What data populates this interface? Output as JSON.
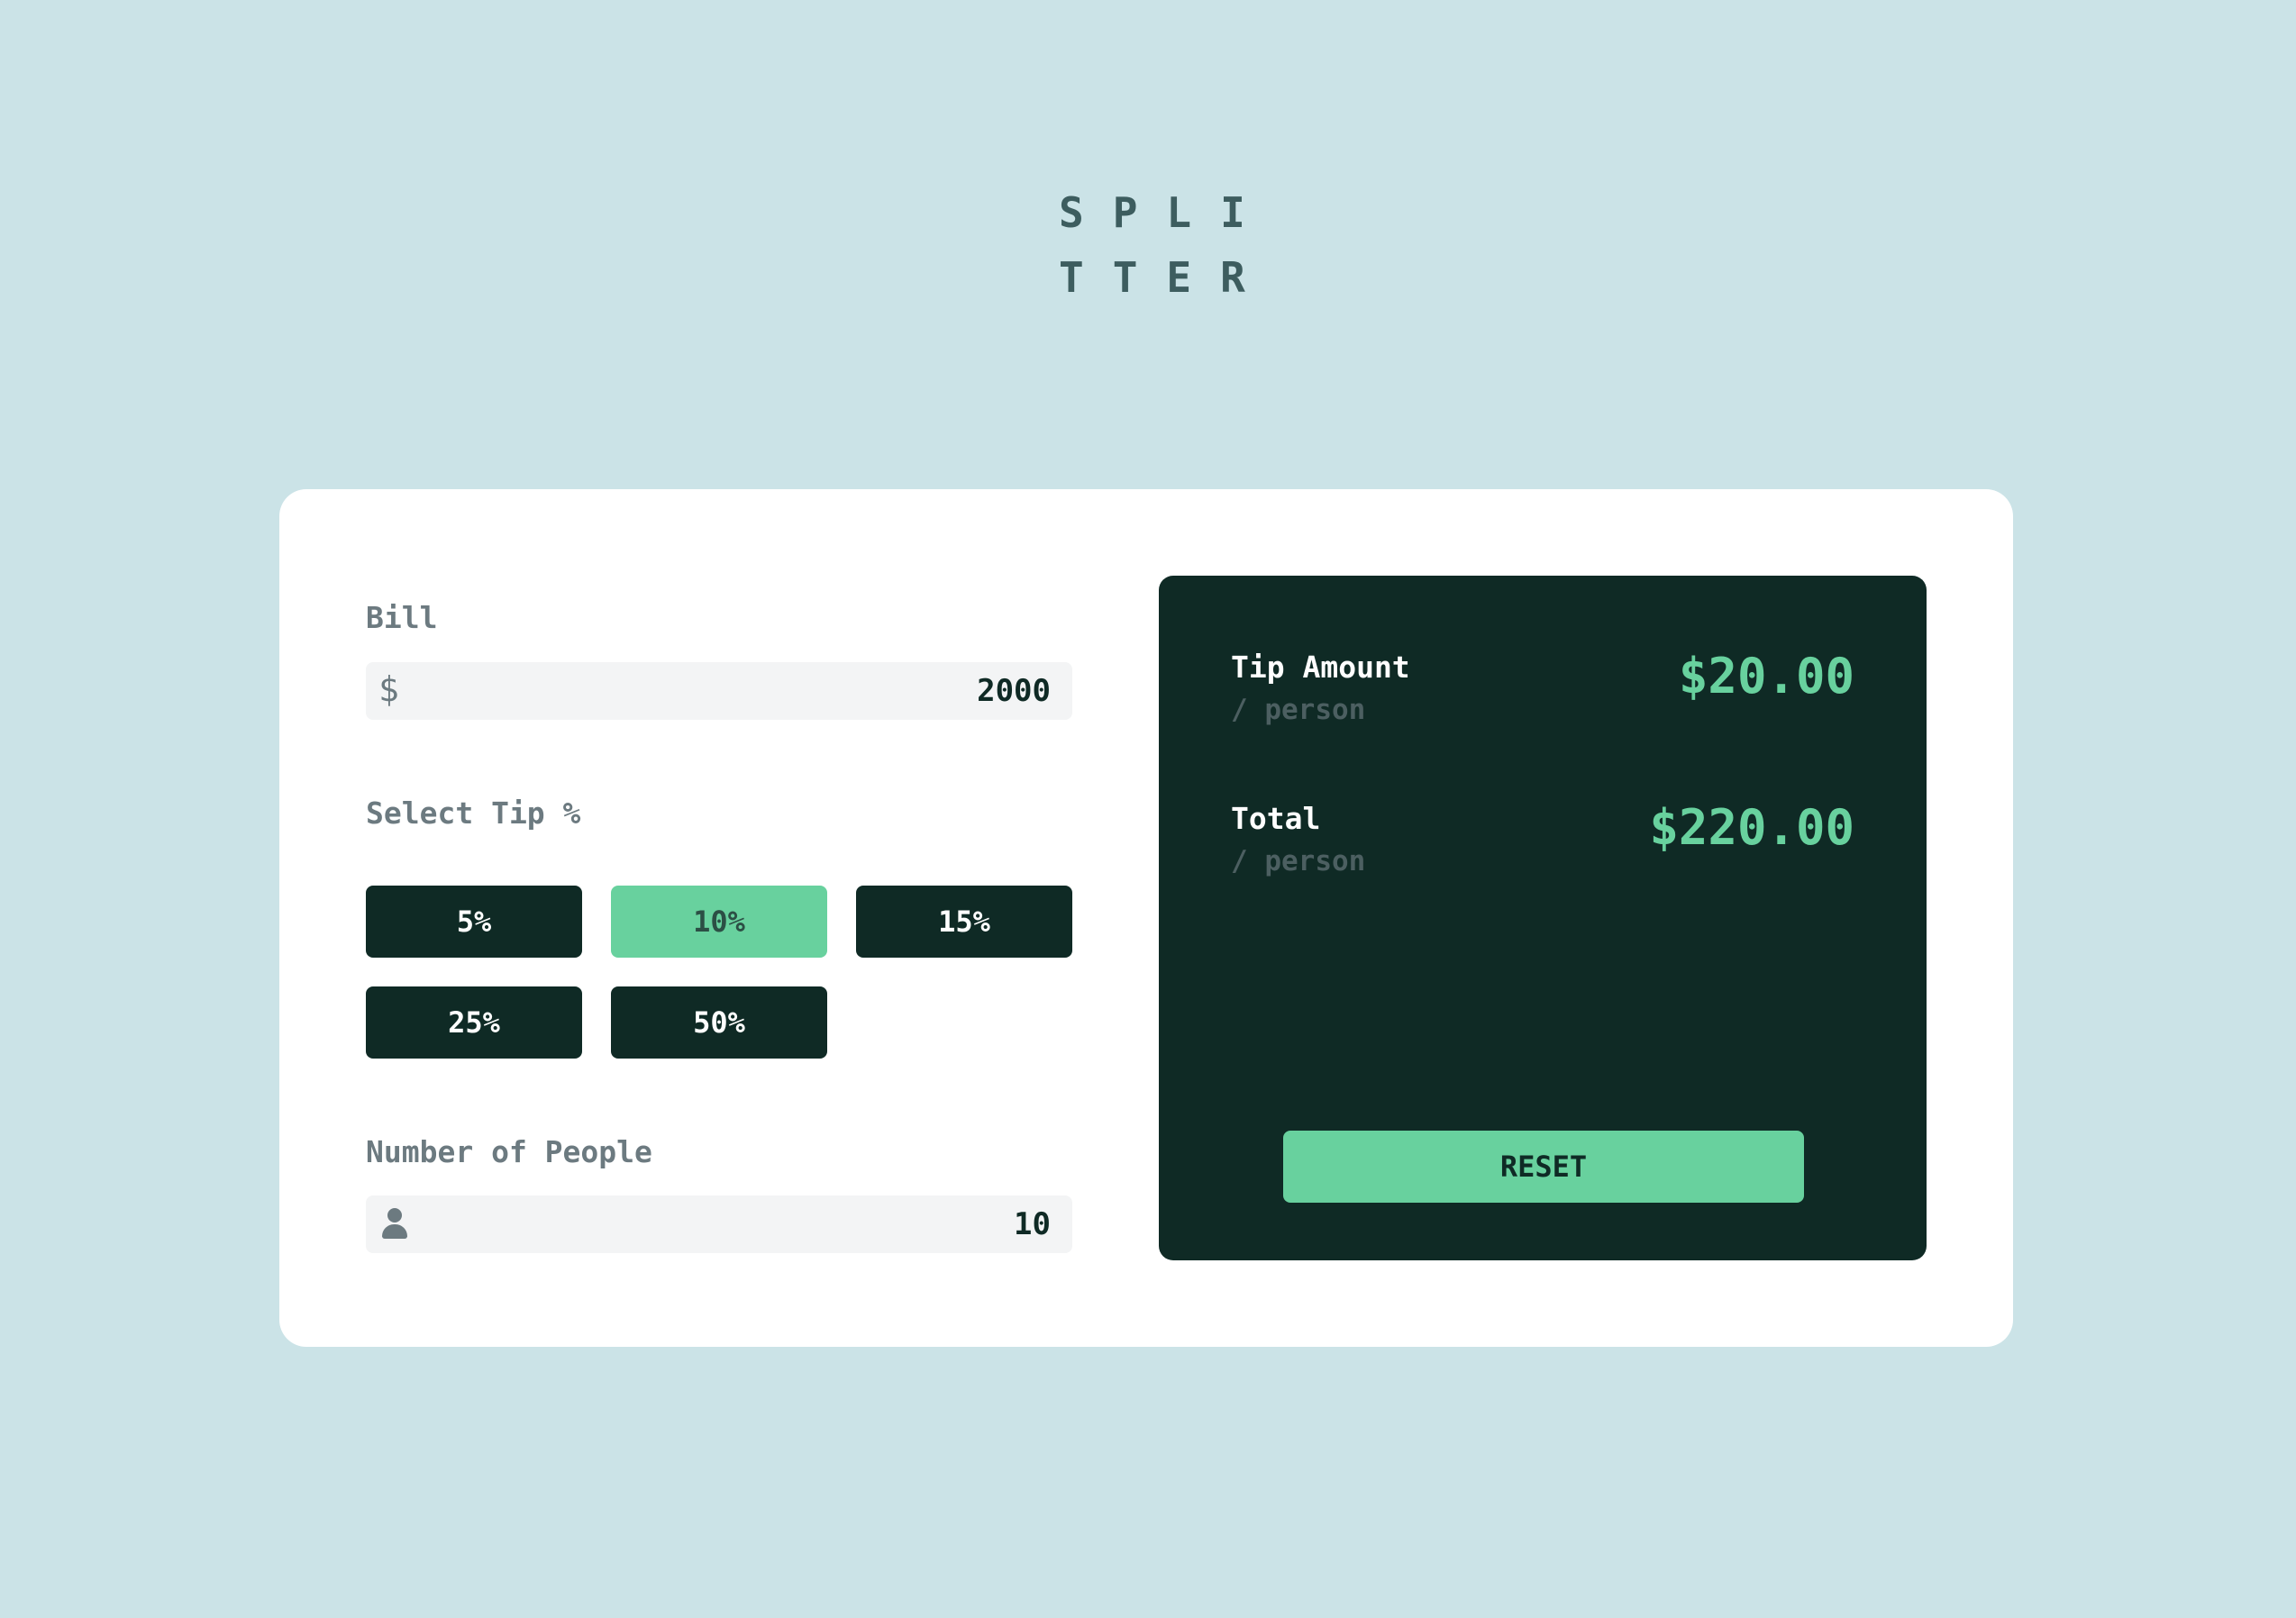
{
  "logo": {
    "line1": "SPLI",
    "line2": "TTER"
  },
  "bill": {
    "label": "Bill",
    "currency_symbol": "$",
    "value": "2000"
  },
  "tip": {
    "label": "Select Tip %",
    "options": [
      "5%",
      "10%",
      "15%",
      "25%",
      "50%"
    ],
    "selected": "10%"
  },
  "people": {
    "label": "Number of People",
    "icon": "person-icon",
    "value": "10"
  },
  "results": {
    "tip_amount": {
      "label": "Tip Amount",
      "sub": "/ person",
      "value": "$20.00"
    },
    "total": {
      "label": "Total",
      "sub": "/ person",
      "value": "$220.00"
    },
    "reset_label": "RESET"
  },
  "colors": {
    "background": "#cbe3e7",
    "card": "#ffffff",
    "dark_green": "#0f2a25",
    "accent": "#68d19e",
    "label_gray": "#6c7a80",
    "logo": "#3d5d5f"
  }
}
